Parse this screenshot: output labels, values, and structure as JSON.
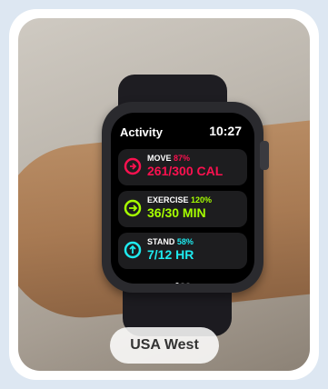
{
  "watch": {
    "title": "Activity",
    "time": "10:27",
    "rings": [
      {
        "name": "MOVE",
        "pct": "87%",
        "value": "261/300 CAL",
        "color": "#fa114f"
      },
      {
        "name": "EXERCISE",
        "pct": "120%",
        "value": "36/30 MIN",
        "color": "#a6ff00"
      },
      {
        "name": "STAND",
        "pct": "58%",
        "value": "7/12 HR",
        "color": "#1eeaef"
      }
    ]
  },
  "caption": "USA West"
}
